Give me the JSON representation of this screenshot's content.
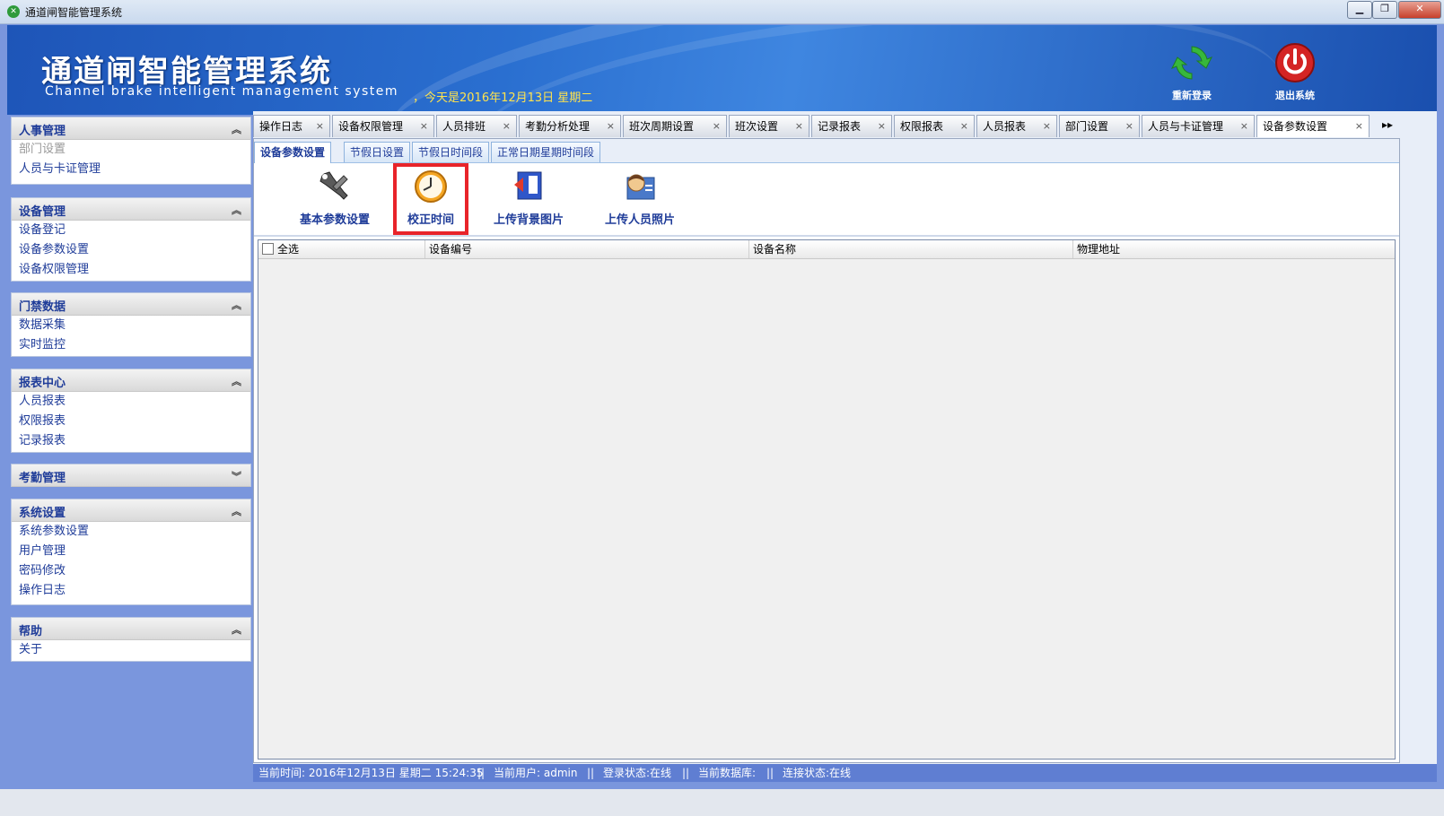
{
  "window": {
    "title": "通道闸智能管理系统"
  },
  "banner": {
    "title": "通道闸智能管理系统",
    "subtitle": "Channel brake intelligent management system",
    "today": "，今天是2016年12月13日  星期二",
    "relogin_label": "重新登录",
    "exit_label": "退出系统"
  },
  "sidebar": {
    "groups": [
      {
        "title": "人事管理",
        "items": [
          "部门设置",
          "人员与卡证管理"
        ]
      },
      {
        "title": "设备管理",
        "items": [
          "设备登记",
          "设备参数设置",
          "设备权限管理"
        ]
      },
      {
        "title": "门禁数据",
        "items": [
          "数据采集",
          "实时监控"
        ]
      },
      {
        "title": "报表中心",
        "items": [
          "人员报表",
          "权限报表",
          "记录报表"
        ]
      },
      {
        "title": "考勤管理",
        "items": []
      },
      {
        "title": "系统设置",
        "items": [
          "系统参数设置",
          "用户管理",
          "密码修改",
          "操作日志"
        ]
      },
      {
        "title": "帮助",
        "items": [
          "关于"
        ]
      }
    ]
  },
  "tabs": [
    {
      "label": "操作日志"
    },
    {
      "label": "设备权限管理"
    },
    {
      "label": "人员排班"
    },
    {
      "label": "考勤分析处理"
    },
    {
      "label": "班次周期设置"
    },
    {
      "label": "班次设置"
    },
    {
      "label": "记录报表"
    },
    {
      "label": "权限报表"
    },
    {
      "label": "人员报表"
    },
    {
      "label": "部门设置"
    },
    {
      "label": "人员与卡证管理"
    },
    {
      "label": "设备参数设置"
    }
  ],
  "tab_close": "×",
  "tab_more": "▸▸",
  "subtabs": [
    "设备参数设置",
    "节假日设置",
    "节假日时间段",
    "正常日期星期时间段"
  ],
  "toolbar": {
    "basic_params": "基本参数设置",
    "calibrate_time": "校正时间",
    "upload_bg": "上传背景图片",
    "upload_photo": "上传人员照片"
  },
  "grid": {
    "select_all": "全选",
    "columns": [
      "设备编号",
      "设备名称",
      "物理地址"
    ]
  },
  "status": {
    "time": "当前时间:  2016年12月13日 星期二   15:24:35",
    "user": "当前用户:  admin",
    "login": "登录状态:在线",
    "db": "当前数据库:",
    "conn": "连接状态:在线",
    "sep": "||"
  },
  "colors": {
    "accent": "#1f3c99",
    "highlight": "#e8242a",
    "banner": "#2a6fd0"
  }
}
